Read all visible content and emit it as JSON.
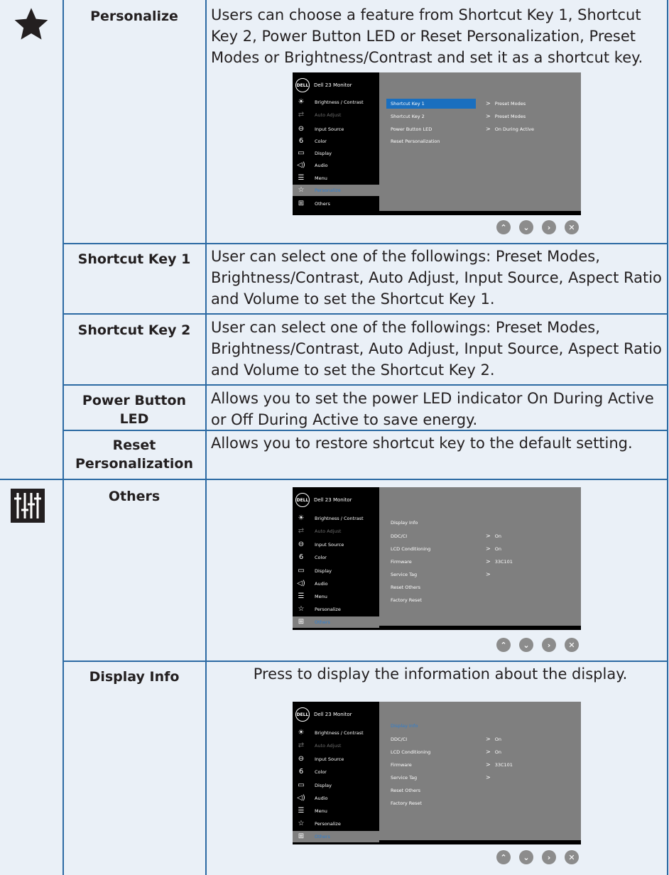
{
  "rows": {
    "personalize": {
      "label": "Personalize",
      "desc": "Users can choose a feature from Shortcut Key 1, Shortcut Key 2, Power Button LED or Reset Personalization, Preset Modes or Brightness/Contrast and set it as a shortcut key."
    },
    "shortcut1": {
      "label": "Shortcut Key 1",
      "desc": "User can select one of the followings: Preset Modes, Brightness/Contrast, Auto Adjust, Input Source, Aspect Ratio and Volume to set the Shortcut Key 1."
    },
    "shortcut2": {
      "label": "Shortcut Key 2",
      "desc": "User can select one of the followings: Preset Modes, Brightness/Contrast, Auto Adjust, Input Source, Aspect Ratio and Volume to set the Shortcut Key 2."
    },
    "powerled": {
      "label_line1": "Power Button",
      "label_line2": "LED",
      "desc": "Allows you to set the power LED indicator On During Active or Off During Active to save energy."
    },
    "resetpers": {
      "label_line1": "Reset",
      "label_line2": "Personalization",
      "desc": "Allows you to restore shortcut key to the default setting."
    },
    "others": {
      "label": "Others"
    },
    "displayinfo": {
      "label": "Display Info",
      "desc": "Press to display the information about the display."
    }
  },
  "osd_common": {
    "logo": "DELL",
    "title": "Dell 23 Monitor",
    "menu": [
      {
        "icon": "brightness-icon",
        "glyph": "☀",
        "label": "Brightness / Contrast"
      },
      {
        "icon": "auto-adjust-icon",
        "glyph": "⇄",
        "label": "Auto Adjust"
      },
      {
        "icon": "input-source-icon",
        "glyph": "⊖",
        "label": "Input Source"
      },
      {
        "icon": "color-icon",
        "glyph": "6",
        "label": "Color"
      },
      {
        "icon": "display-icon",
        "glyph": "▭",
        "label": "Display"
      },
      {
        "icon": "audio-icon",
        "glyph": "◁)",
        "label": "Audio"
      },
      {
        "icon": "menu-icon",
        "glyph": "☰",
        "label": "Menu"
      },
      {
        "icon": "personalize-icon",
        "glyph": "☆",
        "label": "Personalize"
      },
      {
        "icon": "others-icon",
        "glyph": "⊞",
        "label": "Others"
      }
    ]
  },
  "osd_personalize": {
    "options": [
      "Shortcut Key 1",
      "Shortcut Key 2",
      "Power Button LED",
      "Reset Personalization"
    ],
    "values": [
      "Preset Modes",
      "Preset Modes",
      "On During Active"
    ]
  },
  "osd_others": {
    "options": [
      "Display Info",
      "DDC/CI",
      "LCD Conditioning",
      "Firmware",
      "Service Tag",
      "Reset Others",
      "Factory Reset"
    ],
    "values": [
      "On",
      "On",
      "33C101",
      ""
    ]
  },
  "buttons": {
    "up": "⌃",
    "down": "⌄",
    "ok": "›",
    "exit": "✕"
  }
}
